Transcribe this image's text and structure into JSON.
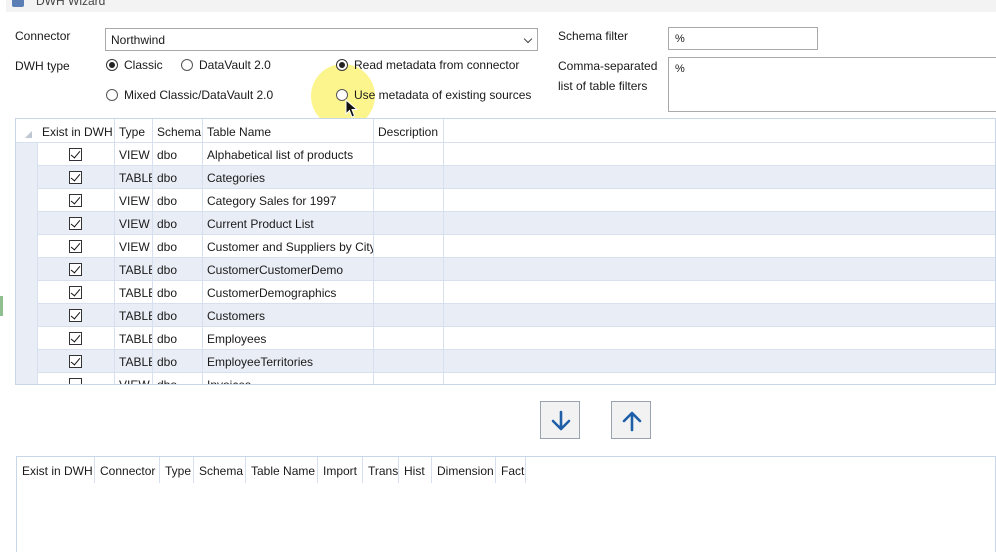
{
  "window": {
    "title": "DWH Wizard"
  },
  "form": {
    "connector_label": "Connector",
    "connector_value": "Northwind",
    "dwh_type_label": "DWH type",
    "schema_filter_label": "Schema filter",
    "schema_filter_value": "%",
    "table_filters_label_line1": "Comma-separated",
    "table_filters_label_line2": "list of table filters",
    "table_filters_value": "%",
    "options": [
      {
        "label": "Classic",
        "selected": true
      },
      {
        "label": "DataVault 2.0",
        "selected": false
      },
      {
        "label": "Mixed Classic/DataVault 2.0",
        "selected": false
      },
      {
        "label": "Read metadata from connector",
        "selected": true
      },
      {
        "label": "Use metadata of existing sources",
        "selected": false
      }
    ]
  },
  "source_table": {
    "columns": [
      "Exist in DWH",
      "Type",
      "Schema",
      "Table Name",
      "Description"
    ],
    "rows": [
      {
        "exist": true,
        "type": "VIEW",
        "schema": "dbo",
        "name": "Alphabetical list of products",
        "description": ""
      },
      {
        "exist": true,
        "type": "TABLE",
        "schema": "dbo",
        "name": "Categories",
        "description": ""
      },
      {
        "exist": true,
        "type": "VIEW",
        "schema": "dbo",
        "name": "Category Sales for 1997",
        "description": ""
      },
      {
        "exist": true,
        "type": "VIEW",
        "schema": "dbo",
        "name": "Current Product List",
        "description": ""
      },
      {
        "exist": true,
        "type": "VIEW",
        "schema": "dbo",
        "name": "Customer and Suppliers by City",
        "description": ""
      },
      {
        "exist": true,
        "type": "TABLE",
        "schema": "dbo",
        "name": "CustomerCustomerDemo",
        "description": ""
      },
      {
        "exist": true,
        "type": "TABLE",
        "schema": "dbo",
        "name": "CustomerDemographics",
        "description": ""
      },
      {
        "exist": true,
        "type": "TABLE",
        "schema": "dbo",
        "name": "Customers",
        "description": ""
      },
      {
        "exist": true,
        "type": "TABLE",
        "schema": "dbo",
        "name": "Employees",
        "description": ""
      },
      {
        "exist": true,
        "type": "TABLE",
        "schema": "dbo",
        "name": "EmployeeTerritories",
        "description": ""
      },
      {
        "exist": false,
        "type": "VIEW",
        "schema": "dbo",
        "name": "Invoices",
        "description": ""
      }
    ]
  },
  "buttons": {
    "move_down_icon": "arrow-down-icon",
    "move_up_icon": "arrow-up-icon"
  },
  "target_table": {
    "columns": [
      "Exist in DWH",
      "Connector",
      "Type",
      "Schema",
      "Table Name",
      "Import",
      "Trans",
      "Hist",
      "Dimension",
      "Fact"
    ]
  },
  "colors": {
    "accent_blue": "#1f5fa8",
    "row_alt": "#e9edf5",
    "cursor_highlight": "#faf050"
  }
}
